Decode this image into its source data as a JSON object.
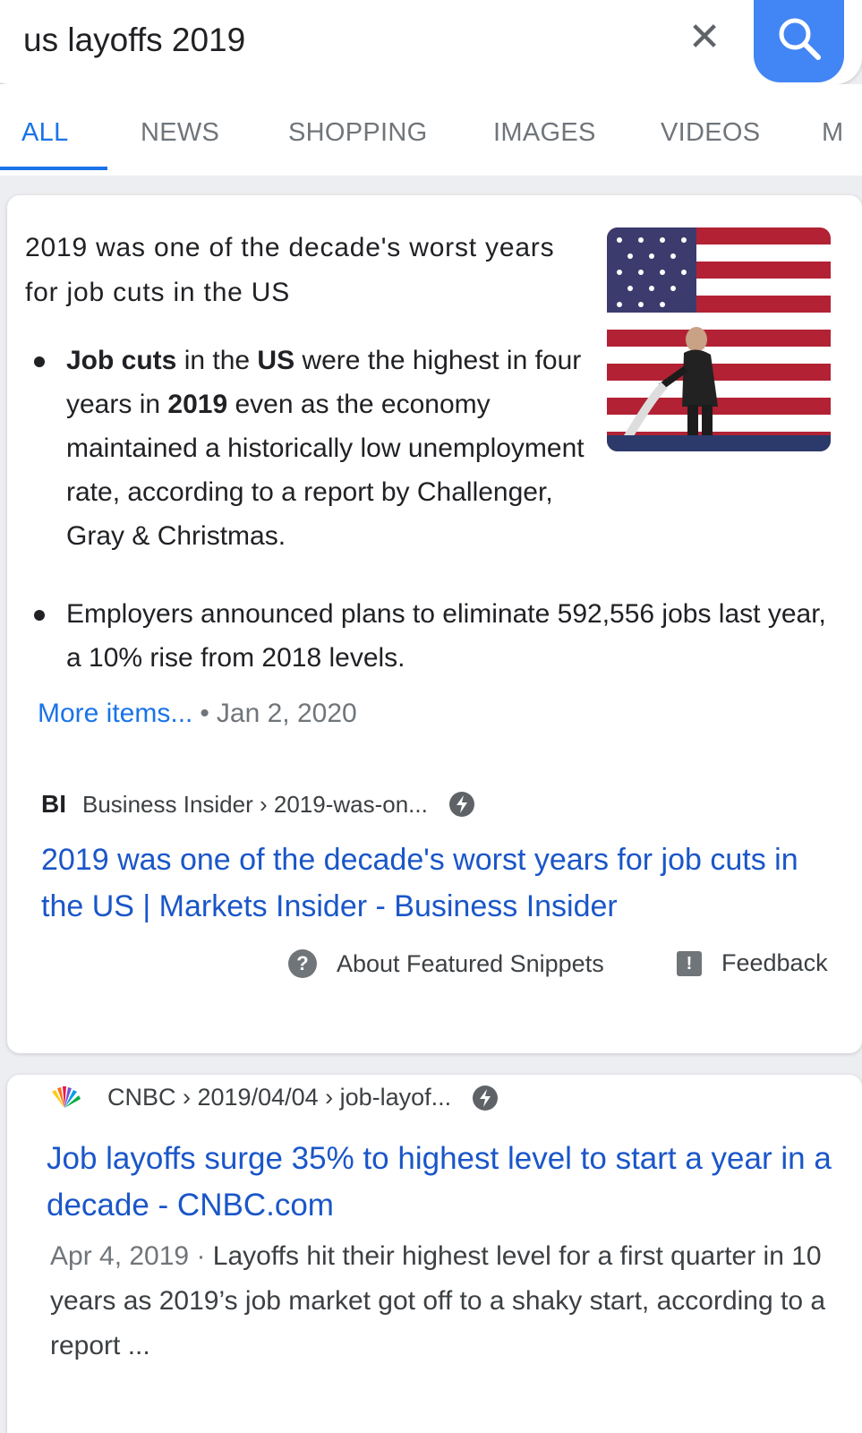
{
  "search": {
    "query": "us layoffs 2019",
    "clear_icon": "close-icon",
    "search_icon": "search-icon",
    "accent": "#4285f4"
  },
  "tabs": [
    {
      "label": "ALL",
      "active": true
    },
    {
      "label": "NEWS"
    },
    {
      "label": "SHOPPING"
    },
    {
      "label": "IMAGES"
    },
    {
      "label": "VIDEOS"
    },
    {
      "label": "M"
    }
  ],
  "featured": {
    "title": "2019 was one of the decade's worst years for job cuts in the US",
    "bullet1": {
      "p1": "Job cuts",
      "p2": " in the ",
      "p3": "US",
      "p4": " were the highest in four years in ",
      "p5": "2019",
      "p6": " even as the economy maintained a historically low unemployment rate, according to a report by Challenger, Gray & Christmas."
    },
    "bullet2": "Employers announced plans to eliminate 592,556 jobs last year, a 10% rise from 2018 levels.",
    "more_link": "More items...",
    "separator": "•",
    "date": "Jan 2, 2020",
    "source_logo": "BI",
    "source": "Business Insider › 2019-was-on...",
    "result_title": "2019 was one of the decade's worst years for job cuts in the US | Markets Insider - Business Insider",
    "about_label": "About Featured Snippets",
    "feedback_label": "Feedback"
  },
  "result2": {
    "source": "CNBC › 2019/04/04 › job-layof...",
    "title": "Job layoffs surge 35% to highest level to start a year in a decade - CNBC.com",
    "date": "Apr 4, 2019",
    "separator": " · ",
    "snippet": "Layoffs hit their highest level for a first quarter in 10 years as 2019’s job market got off to a shaky start, according to a report ..."
  }
}
